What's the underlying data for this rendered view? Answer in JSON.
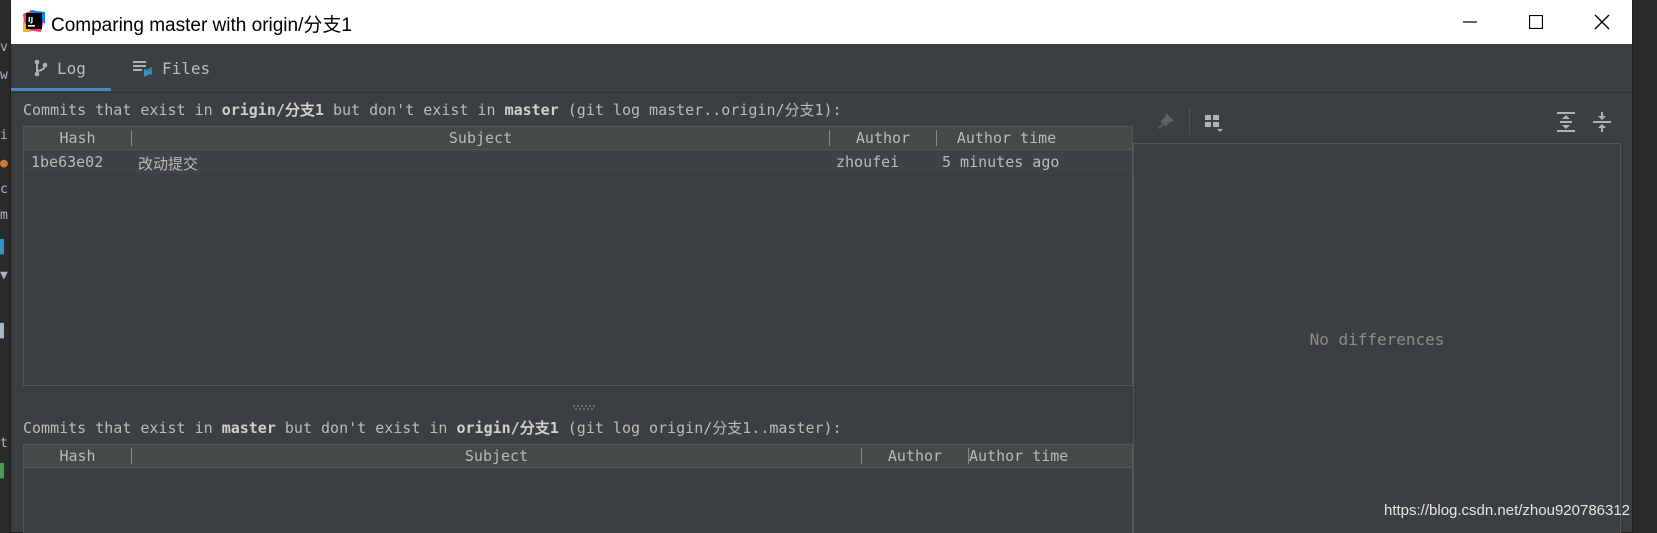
{
  "window": {
    "title": "Comparing master with origin/分支1"
  },
  "tabs": [
    {
      "label": "Log",
      "icon": "branch-icon",
      "active": true
    },
    {
      "label": "Files",
      "icon": "files-diff-icon",
      "active": false
    }
  ],
  "top_section": {
    "caption_prefix": "Commits that exist in ",
    "caption_bold1": "origin/分支1",
    "caption_mid": " but don't exist in ",
    "caption_bold2": "master",
    "caption_suffix": " (git log master..origin/分支1):",
    "columns": [
      "Hash",
      "Subject",
      "Author",
      "Author time"
    ],
    "rows": [
      {
        "hash": "1be63e02",
        "subject": "改动提交",
        "author": "zhoufei",
        "time": "5 minutes ago"
      }
    ]
  },
  "bottom_section": {
    "caption_prefix": "Commits that exist in ",
    "caption_bold1": "master",
    "caption_mid": " but don't exist in ",
    "caption_bold2": "origin/分支1",
    "caption_suffix": " (git log origin/分支1..master):",
    "columns": [
      "Hash",
      "Subject",
      "Author",
      "Author time"
    ]
  },
  "diff_panel": {
    "empty_text": "No differences"
  },
  "watermark": "https://blog.csdn.net/zhou920786312",
  "colors": {
    "accent": "#4a88c7",
    "background": "#3c3f41",
    "header": "#45494a"
  }
}
